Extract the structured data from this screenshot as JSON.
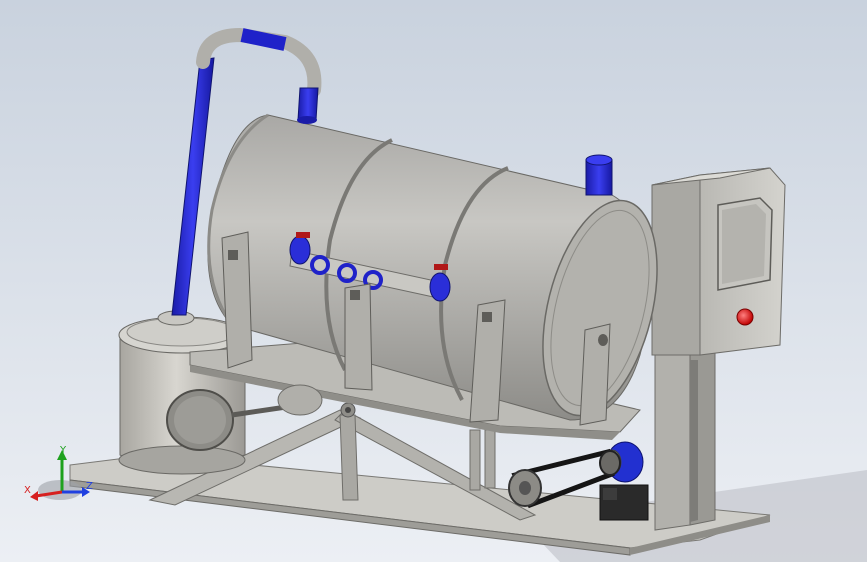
{
  "viewport": {
    "background_top": "#c9d2de",
    "background_bottom": "#e9edf3"
  },
  "model": {
    "metal_color": "#b7b6b2",
    "metal_dark": "#7e7d79",
    "metal_light": "#d3d2ce",
    "pipe_color": "#1f22c9",
    "belt_color": "#1b1b1b",
    "indicator_light_color": "#e01010"
  },
  "triad": {
    "y_label": "Y",
    "x_label": "X",
    "z_label": "Z",
    "y_color": "#1ea11e",
    "x_color": "#d62020",
    "z_color": "#2040e0"
  }
}
